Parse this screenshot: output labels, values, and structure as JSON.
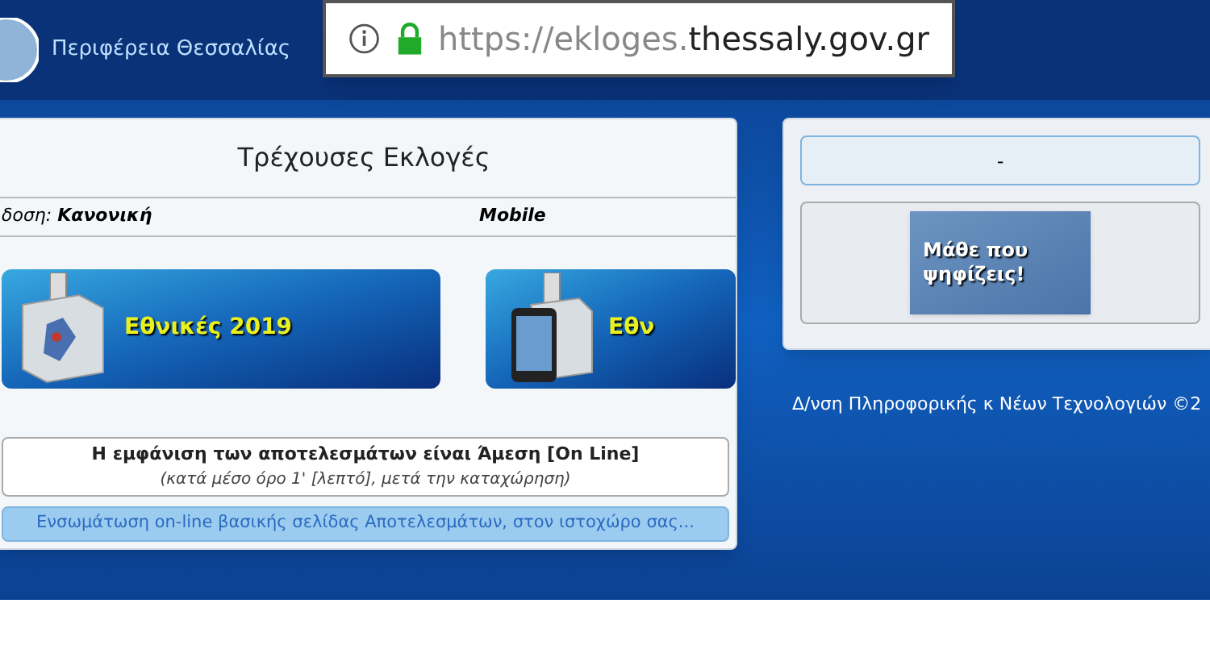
{
  "header": {
    "title": "Περιφέρεια Θεσσαλίας"
  },
  "address_bar": {
    "url_prefix": "https://ekloges.",
    "url_domain": "thessaly.gov.gr"
  },
  "panel": {
    "title": "Τρέχουσες Εκλογές",
    "columns": [
      {
        "label": "δοση:",
        "value": "Κανονική"
      },
      {
        "label": "Mobile"
      }
    ],
    "banners": [
      {
        "kind": "desktop",
        "text": "Εθνικές 2019"
      },
      {
        "kind": "mobile",
        "text": "Εθν"
      }
    ],
    "notice": {
      "heading": "Η εμφάνιση των αποτελεσμάτων είναι Άμεση [On Line]",
      "note": "(κατά μέσο όρο 1' [λεπτό], μετά την καταχώρηση)"
    },
    "embed_link": "Ενσωμάτωση on-line βασικής σελίδας Αποτελεσμάτων, στον ιστοχώρο σας..."
  },
  "side_panel": {
    "button": "-",
    "banner": "Μάθε που ψηφίζεις!"
  },
  "footer": "Δ/νση Πληροφορικής κ Νέων Τεχνολογιών ©2"
}
